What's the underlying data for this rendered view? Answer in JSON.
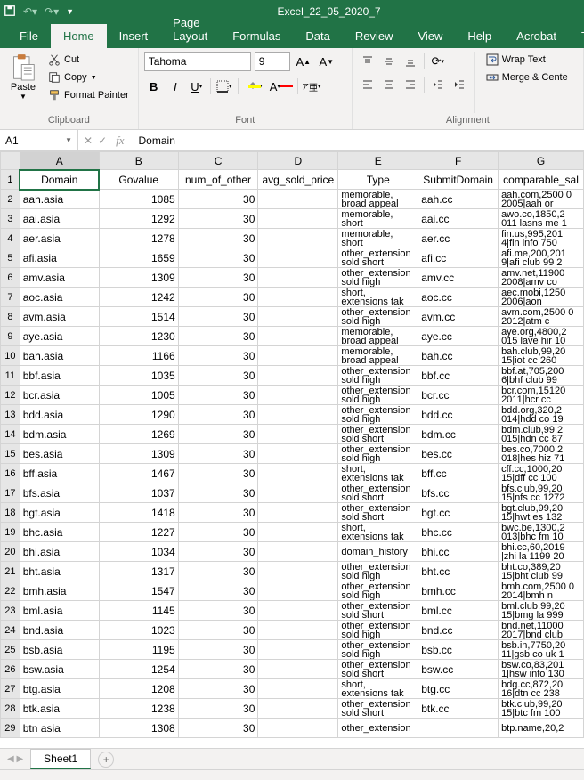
{
  "app": {
    "title": "Excel_22_05_2020_7"
  },
  "qat": {
    "save": "save-icon",
    "undo": "undo-icon",
    "redo": "redo-icon"
  },
  "tabs": {
    "file": "File",
    "home": "Home",
    "insert": "Insert",
    "page_layout": "Page Layout",
    "formulas": "Formulas",
    "data": "Data",
    "review": "Review",
    "view": "View",
    "help": "Help",
    "acrobat": "Acrobat",
    "team": "Tea"
  },
  "ribbon": {
    "clipboard": {
      "label": "Clipboard",
      "paste": "Paste",
      "cut": "Cut",
      "copy": "Copy",
      "format_painter": "Format Painter"
    },
    "font": {
      "label": "Font",
      "name": "Tahoma",
      "size": "9"
    },
    "alignment": {
      "label": "Alignment",
      "wrap_text": "Wrap Text",
      "merge_center": "Merge & Cente"
    }
  },
  "namebox": {
    "ref": "A1"
  },
  "formula_bar": {
    "value": "Domain"
  },
  "columns": [
    "A",
    "B",
    "C",
    "D",
    "E",
    "F",
    "G"
  ],
  "headers": {
    "A": "Domain",
    "B": "Govalue",
    "C": "num_of_other",
    "D": "avg_sold_price",
    "E": "Type",
    "F": "SubmitDomain",
    "G": "comparable_sal"
  },
  "rows": [
    {
      "r": 2,
      "A": "aah.asia",
      "B": 1085,
      "C": 30,
      "E": "memorable, broad appeal",
      "F": "aah.cc",
      "G": "aah.com,2500 0 2005|aah or"
    },
    {
      "r": 3,
      "A": "aai.asia",
      "B": 1292,
      "C": 30,
      "E": "memorable, short",
      "F": "aai.cc",
      "G": "awo.co,1850,2 011 lasns me 1"
    },
    {
      "r": 4,
      "A": "aer.asia",
      "B": 1278,
      "C": 30,
      "E": "memorable, short",
      "F": "aer.cc",
      "G": "fin.us,995,201 4|fin info 750"
    },
    {
      "r": 5,
      "A": "afi.asia",
      "B": 1659,
      "C": 30,
      "E": "other_extension sold short",
      "F": "afi.cc",
      "G": "afi.me,200,201 9|afi club 99 2"
    },
    {
      "r": 6,
      "A": "amv.asia",
      "B": 1309,
      "C": 30,
      "E": "other_extension sold high",
      "F": "amv.cc",
      "G": "amv.net,11900 2008|amv co"
    },
    {
      "r": 7,
      "A": "aoc.asia",
      "B": 1242,
      "C": 30,
      "E": "short, extensions tak",
      "F": "aoc.cc",
      "G": "aec.mobi,1250 2006|aon"
    },
    {
      "r": 8,
      "A": "avm.asia",
      "B": 1514,
      "C": 30,
      "E": "other_extension sold high",
      "F": "avm.cc",
      "G": "avm.com,2500 0 2012|atm c"
    },
    {
      "r": 9,
      "A": "aye.asia",
      "B": 1230,
      "C": 30,
      "E": "memorable, broad appeal",
      "F": "aye.cc",
      "G": "aye.org,4800,2 015 lave hir 10"
    },
    {
      "r": 10,
      "A": "bah.asia",
      "B": 1166,
      "C": 30,
      "E": "memorable, broad appeal",
      "F": "bah.cc",
      "G": "bah.club,99,20 15|iot cc 260"
    },
    {
      "r": 11,
      "A": "bbf.asia",
      "B": 1035,
      "C": 30,
      "E": "other_extension sold high",
      "F": "bbf.cc",
      "G": "bbf.at,705,200 6|bhf club 99"
    },
    {
      "r": 12,
      "A": "bcr.asia",
      "B": 1005,
      "C": 30,
      "E": "other_extension sold high",
      "F": "bcr.cc",
      "G": "bcr.com,15120 2011|hcr cc"
    },
    {
      "r": 13,
      "A": "bdd.asia",
      "B": 1290,
      "C": 30,
      "E": "other_extension sold high",
      "F": "bdd.cc",
      "G": "bdd.org,320,2 014|hdd co 19"
    },
    {
      "r": 14,
      "A": "bdm.asia",
      "B": 1269,
      "C": 30,
      "E": "other_extension sold short",
      "F": "bdm.cc",
      "G": "bdm.club,99,2 015|hdn cc 87"
    },
    {
      "r": 15,
      "A": "bes.asia",
      "B": 1309,
      "C": 30,
      "E": "other_extension sold high",
      "F": "bes.cc",
      "G": "bes.co,7000,2 018|hes hiz 71"
    },
    {
      "r": 16,
      "A": "bff.asia",
      "B": 1467,
      "C": 30,
      "E": "short, extensions tak",
      "F": "bff.cc",
      "G": "cff.cc,1000,20 15|dff cc 100"
    },
    {
      "r": 17,
      "A": "bfs.asia",
      "B": 1037,
      "C": 30,
      "E": "other_extension sold short",
      "F": "bfs.cc",
      "G": "bfs.club,99,20 15|nfs cc 1272"
    },
    {
      "r": 18,
      "A": "bgt.asia",
      "B": 1418,
      "C": 30,
      "E": "other_extension sold short",
      "F": "bgt.cc",
      "G": "bgt.club,99,20 15|hwt es 132"
    },
    {
      "r": 19,
      "A": "bhc.asia",
      "B": 1227,
      "C": 30,
      "E": "short, extensions tak",
      "F": "bhc.cc",
      "G": "bwc.be,1300,2 013|bhc fm 10"
    },
    {
      "r": 20,
      "A": "bhi.asia",
      "B": 1034,
      "C": 30,
      "E": "domain_history",
      "F": "bhi.cc",
      "G": "bhi.cc,60,2019 |zhi la 1199 20"
    },
    {
      "r": 21,
      "A": "bht.asia",
      "B": 1317,
      "C": 30,
      "E": "other_extension sold high",
      "F": "bht.cc",
      "G": "bht.co,389,20 15|bht club 99"
    },
    {
      "r": 22,
      "A": "bmh.asia",
      "B": 1547,
      "C": 30,
      "E": "other_extension sold high",
      "F": "bmh.cc",
      "G": "bmh.com,2500 0 2014|bmh n"
    },
    {
      "r": 23,
      "A": "bml.asia",
      "B": 1145,
      "C": 30,
      "E": "other_extension sold short",
      "F": "bml.cc",
      "G": "bml.club,99,20 15|bmg la 999"
    },
    {
      "r": 24,
      "A": "bnd.asia",
      "B": 1023,
      "C": 30,
      "E": "other_extension sold high",
      "F": "bnd.cc",
      "G": "bnd.net,11000 2017|bnd club"
    },
    {
      "r": 25,
      "A": "bsb.asia",
      "B": 1195,
      "C": 30,
      "E": "other_extension sold high",
      "F": "bsb.cc",
      "G": "bsb.in,7750,20 11|gsb co uk 1"
    },
    {
      "r": 26,
      "A": "bsw.asia",
      "B": 1254,
      "C": 30,
      "E": "other_extension sold short",
      "F": "bsw.cc",
      "G": "bsw.co,83,201 1|hsw info 130"
    },
    {
      "r": 27,
      "A": "btg.asia",
      "B": 1208,
      "C": 30,
      "E": "short, extensions tak",
      "F": "btg.cc",
      "G": "bdg.cc,872,20 16|dtn cc 238"
    },
    {
      "r": 28,
      "A": "btk.asia",
      "B": 1238,
      "C": 30,
      "E": "other_extension sold short",
      "F": "btk.cc",
      "G": "btk.club,99,20 15|btc fm 100"
    },
    {
      "r": 29,
      "A": "btn asia",
      "B": 1308,
      "C": 30,
      "E": "other_extension",
      "F": "",
      "G": "btp.name,20,2"
    }
  ],
  "sheets": {
    "active": "Sheet1"
  }
}
